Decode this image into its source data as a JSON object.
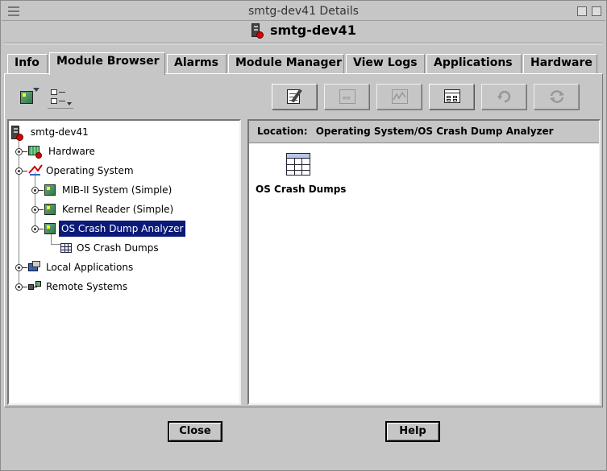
{
  "window": {
    "title": "smtg-dev41 Details"
  },
  "header": {
    "host": "smtg-dev41"
  },
  "tabs": [
    {
      "label": "Info"
    },
    {
      "label": "Module Browser"
    },
    {
      "label": "Alarms"
    },
    {
      "label": "Module Manager"
    },
    {
      "label": "View Logs"
    },
    {
      "label": "Applications"
    },
    {
      "label": "Hardware"
    }
  ],
  "active_tab": "Module Browser",
  "toolbar": {
    "left": [
      {
        "icon": "module-cube-icon"
      },
      {
        "icon": "tree-view-icon"
      }
    ],
    "right": [
      {
        "icon": "edit-properties-icon",
        "enabled": true
      },
      {
        "icon": "graph-icon",
        "enabled": false
      },
      {
        "icon": "chart-icon",
        "enabled": false
      },
      {
        "icon": "table-view-icon",
        "enabled": true
      },
      {
        "icon": "refresh-icon",
        "enabled": false
      },
      {
        "icon": "reload-icon",
        "enabled": false
      }
    ]
  },
  "tree": {
    "root": "smtg-dev41",
    "items": [
      {
        "label": "Hardware"
      },
      {
        "label": "Operating System"
      },
      {
        "label": "MIB-II System (Simple)"
      },
      {
        "label": "Kernel Reader (Simple)"
      },
      {
        "label": "OS Crash Dump Analyzer",
        "selected": true
      },
      {
        "label": "OS Crash Dumps"
      },
      {
        "label": "Local Applications"
      },
      {
        "label": "Remote Systems"
      }
    ]
  },
  "content": {
    "location_label": "Location:",
    "location_path": "Operating System/OS Crash Dump Analyzer",
    "items": [
      {
        "label": "OS Crash Dumps",
        "icon": "table-icon"
      }
    ]
  },
  "buttons": {
    "close": "Close",
    "help": "Help"
  },
  "colors": {
    "selection": "#0a1a78",
    "alarm": "#d00000",
    "background": "#c6c6c6"
  }
}
